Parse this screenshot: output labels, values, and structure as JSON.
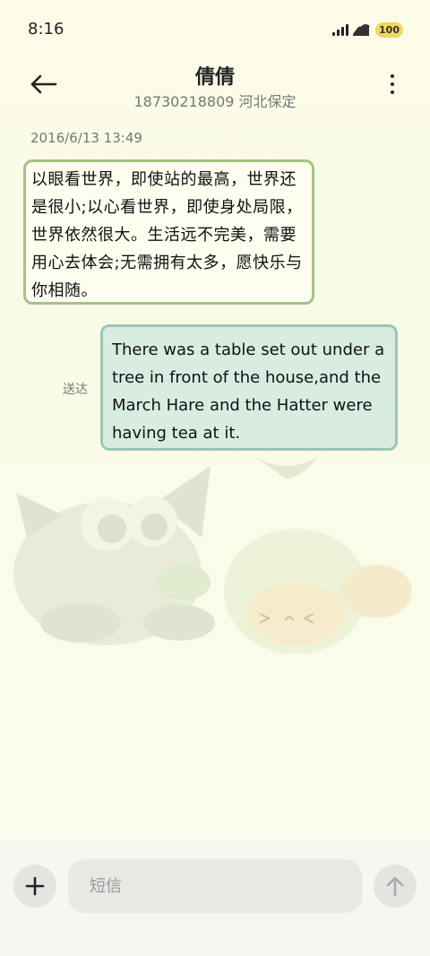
{
  "status_bar": {
    "time": "8:16",
    "battery": "100",
    "icons": [
      "signal-icon",
      "wifi-icon",
      "battery-icon"
    ]
  },
  "header": {
    "back_icon": "arrow-left-icon",
    "contact_name": "倩倩",
    "contact_sub": "18730218809 河北保定",
    "more_icon": "more-vertical-icon"
  },
  "conversation": {
    "timestamp": "2016/6/13 13:49",
    "messages": [
      {
        "direction": "incoming",
        "text": "以眼看世界，即使站的最高，世界还是很小;以心看世界，即使身处局限，世界依然很大。生活远不完美，需要用心去体会;无需拥有太多，愿快乐与你相随。"
      },
      {
        "direction": "outgoing",
        "text": "There was a table set out under a tree in front of the house,and the March Hare and the Hatter were having tea at it.",
        "status": "送达"
      }
    ]
  },
  "composer": {
    "add_icon": "plus-icon",
    "placeholder": "短信",
    "send_icon": "arrow-up-icon"
  },
  "colors": {
    "incoming_border": "#a4c287",
    "outgoing_bg": "#d8ece2",
    "outgoing_border": "#9cc7b5",
    "background": "#fbfbe7"
  }
}
